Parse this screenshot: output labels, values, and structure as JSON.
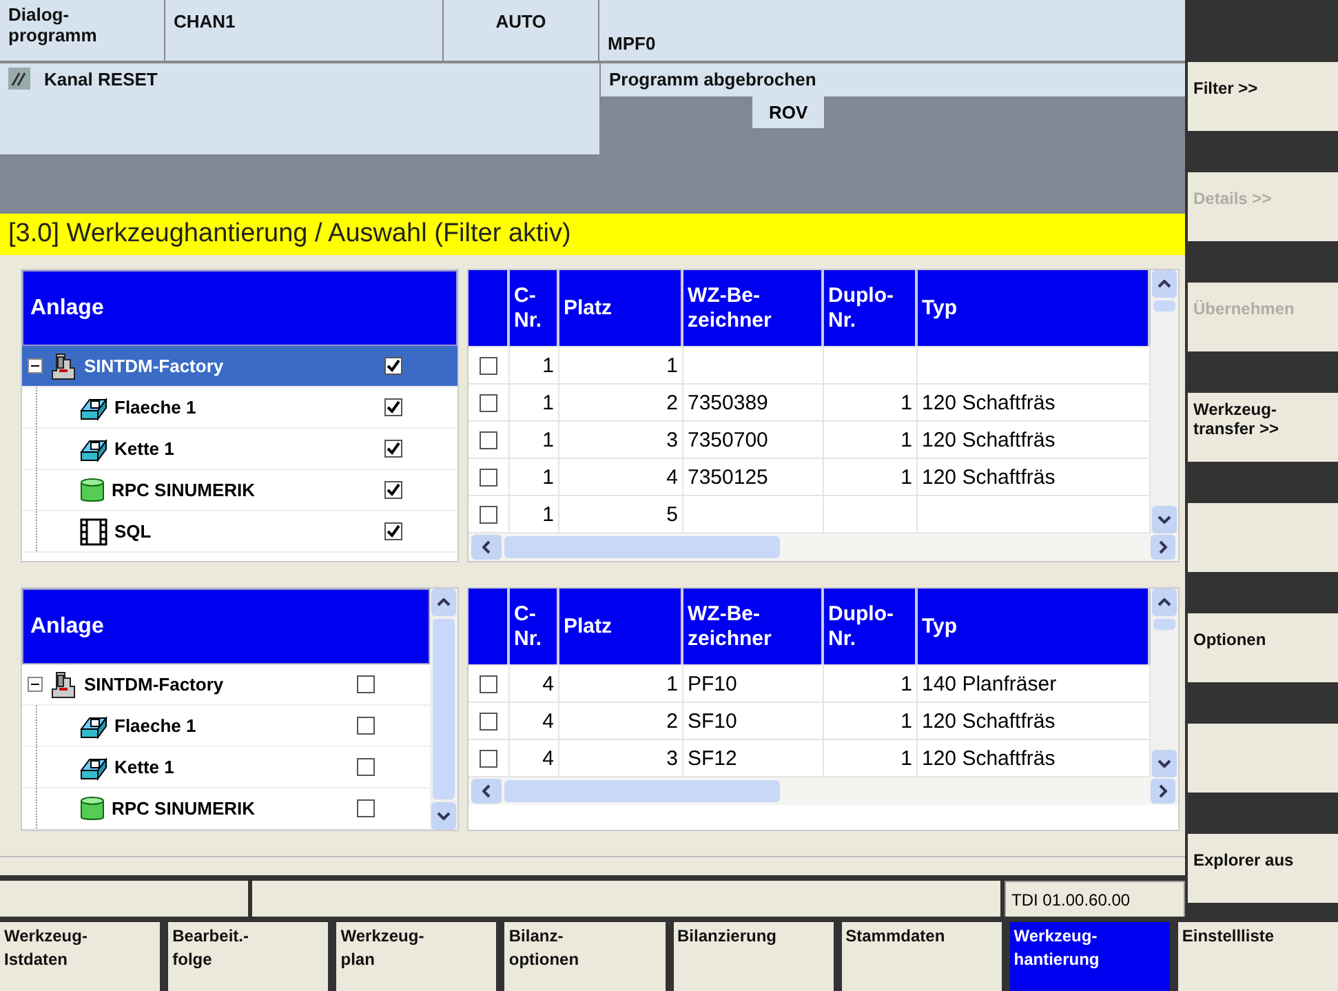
{
  "header": {
    "mode": "Dialog-\nprogramm",
    "channel": "CHAN1",
    "op_mode": "AUTO",
    "program": "MPF0",
    "channel_state": "Kanal RESET",
    "program_state": "Programm abgebrochen",
    "rov": "ROV"
  },
  "title": "[3.0] Werkzeughantierung / Auswahl (Filter aktiv)",
  "upper": {
    "tree": {
      "heading": "Anlage",
      "items": [
        {
          "label": "SINTDM-Factory",
          "kind": "machine",
          "checked": true,
          "selected": true,
          "expanded": true,
          "children": [
            {
              "label": "Flaeche 1",
              "kind": "workpiece",
              "checked": true,
              "selected": false
            },
            {
              "label": "Kette 1",
              "kind": "workpiece",
              "checked": true,
              "selected": false
            },
            {
              "label": "RPC SINUMERIK",
              "kind": "database",
              "checked": true,
              "selected": false
            },
            {
              "label": "SQL",
              "kind": "film",
              "checked": true,
              "selected": false
            }
          ]
        }
      ]
    },
    "table": {
      "columns": [
        "C-\nNr.",
        "Platz",
        "WZ-Be-\nzeichner",
        "Duplo-\nNr.",
        "Typ"
      ],
      "rows": [
        {
          "checked": false,
          "cells": [
            "1",
            "1",
            "",
            "",
            ""
          ]
        },
        {
          "checked": false,
          "cells": [
            "1",
            "2",
            "7350389",
            "1",
            "120 Schaftfräs"
          ]
        },
        {
          "checked": false,
          "cells": [
            "1",
            "3",
            "7350700",
            "1",
            "120 Schaftfräs"
          ]
        },
        {
          "checked": false,
          "cells": [
            "1",
            "4",
            "7350125",
            "1",
            "120 Schaftfräs"
          ]
        },
        {
          "checked": false,
          "cells": [
            "1",
            "5",
            "",
            "",
            ""
          ]
        }
      ]
    }
  },
  "lower": {
    "tree": {
      "heading": "Anlage",
      "items": [
        {
          "label": "SINTDM-Factory",
          "kind": "machine",
          "checked": false,
          "selected": false,
          "expanded": true,
          "children": [
            {
              "label": "Flaeche 1",
              "kind": "workpiece",
              "checked": false,
              "selected": false
            },
            {
              "label": "Kette 1",
              "kind": "workpiece",
              "checked": false,
              "selected": false
            },
            {
              "label": "RPC SINUMERIK",
              "kind": "database",
              "checked": false,
              "selected": false
            }
          ]
        }
      ]
    },
    "table": {
      "columns": [
        "C-\nNr.",
        "Platz",
        "WZ-Be-\nzeichner",
        "Duplo-\nNr.",
        "Typ"
      ],
      "rows": [
        {
          "checked": false,
          "cells": [
            "4",
            "1",
            "PF10",
            "1",
            "140 Planfräser"
          ]
        },
        {
          "checked": false,
          "cells": [
            "4",
            "2",
            "SF10",
            "1",
            "120 Schaftfräs"
          ]
        },
        {
          "checked": false,
          "cells": [
            "4",
            "3",
            "SF12",
            "1",
            "120 Schaftfräs"
          ]
        }
      ]
    }
  },
  "status_bar": {
    "version": "TDI 01.00.60.00"
  },
  "vertical_softkeys": [
    {
      "kind": "key",
      "label": "Filter >>",
      "disabled": false
    },
    {
      "kind": "key",
      "label": "Details >>",
      "disabled": true
    },
    {
      "kind": "key",
      "label": "Übernehmen",
      "disabled": true
    },
    {
      "kind": "key",
      "label": "Werkzeug-\ntransfer >>",
      "disabled": false
    },
    {
      "kind": "blank"
    },
    {
      "kind": "key",
      "label": "Optionen",
      "disabled": false
    },
    {
      "kind": "blank"
    },
    {
      "kind": "key",
      "label": "Explorer aus",
      "disabled": false
    }
  ],
  "horizontal_softkeys": [
    {
      "label": "Werkzeug-\nIstdaten",
      "selected": false
    },
    {
      "label": "Bearbeit.-\nfolge",
      "selected": false
    },
    {
      "label": "Werkzeug-\nplan",
      "selected": false
    },
    {
      "label": "Bilanz-\noptionen",
      "selected": false
    },
    {
      "label": "Bilanzierung",
      "selected": false
    },
    {
      "label": "Stammdaten",
      "selected": false
    },
    {
      "label": "Werkzeug-\nhantierung",
      "selected": true
    },
    {
      "label": "Einstellliste",
      "selected": false
    }
  ]
}
